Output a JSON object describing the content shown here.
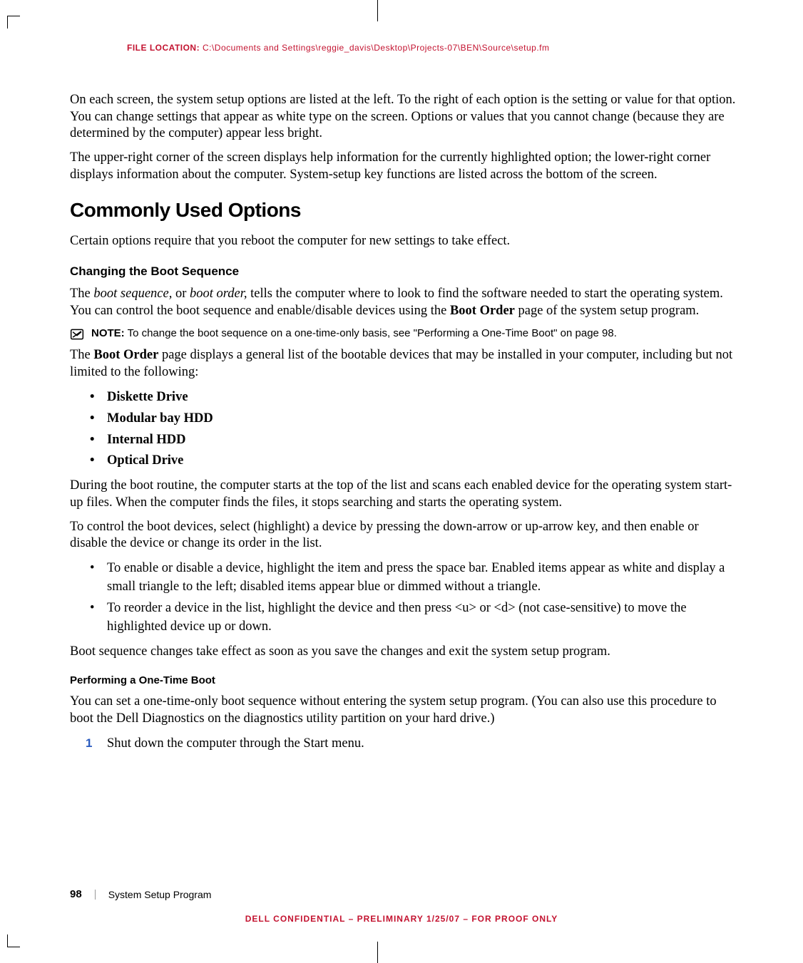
{
  "file_location_label": "FILE LOCATION:",
  "file_location_path": "  C:\\Documents and Settings\\reggie_davis\\Desktop\\Projects-07\\BEN\\Source\\setup.fm",
  "para_intro1": "On each screen, the system setup options are listed at the left. To the right of each option is the setting or value for that option. You can change settings that appear as white type on the screen. Options or values that you cannot change (because they are determined by the computer) appear less bright.",
  "para_intro2": "The upper-right corner of the screen displays help information for the currently highlighted option; the lower-right corner displays information about the computer. System-setup key functions are listed across the bottom of the screen.",
  "h2_common": "Commonly Used Options",
  "para_common": "Certain options require that you reboot the computer for new settings to take effect.",
  "h3_changing": "Changing the Boot Sequence",
  "para_bootseq_pre": "The ",
  "para_bootseq_it1": "boot sequence,",
  "para_bootseq_mid1": " or ",
  "para_bootseq_it2": "boot order,",
  "para_bootseq_mid2": " tells the computer where to look to find the software needed to start the operating system. You can control the boot sequence and enable/disable devices using the ",
  "para_bootseq_bold": "Boot Order",
  "para_bootseq_end": " page of the system setup program.",
  "note_label": "NOTE:",
  "note_text": " To change the boot sequence on a one-time-only basis, see \"Performing a One-Time Boot\" on page 98.",
  "para_bootorder_pre": "The ",
  "para_bootorder_bold": "Boot Order",
  "para_bootorder_end": " page displays a general list of the bootable devices that may be installed in your computer, including but not limited to the following:",
  "devices": {
    "d0": "Diskette Drive",
    "d1": "Modular bay HDD",
    "d2": "Internal HDD",
    "d3": "Optical Drive"
  },
  "para_during": "During the boot routine, the computer starts at the top of the list and scans each enabled device for the operating system start-up files. When the computer finds the files, it stops searching and starts the operating system.",
  "para_control": "To control the boot devices, select (highlight) a device by pressing the down-arrow or up-arrow key, and then enable or disable the device or change its order in the list.",
  "bullets2": {
    "b0": "To enable or disable a device, highlight the item and press the space bar. Enabled items appear as white and display a small triangle to the left; disabled items appear blue or dimmed without a triangle.",
    "b1": "To reorder a device in the list, highlight the device and then press <u> or <d> (not case-sensitive) to move the highlighted device up or down."
  },
  "para_bootchanges": "Boot sequence changes take effect as soon as you save the changes and exit the system setup program.",
  "h4_onetime": "Performing a One-Time Boot",
  "para_onetime": "You can set a one-time-only boot sequence without entering the system setup program. (You can also use this procedure to boot the Dell Diagnostics on the diagnostics utility partition on your hard drive.)",
  "step1_num": "1",
  "step1_pre": "Shut down the computer through the ",
  "step1_bold": "Start",
  "step1_end": " menu.",
  "confidential": "DELL CONFIDENTIAL – PRELIMINARY 1/25/07 – FOR PROOF ONLY",
  "page_number": "98",
  "section_title": "System Setup Program"
}
